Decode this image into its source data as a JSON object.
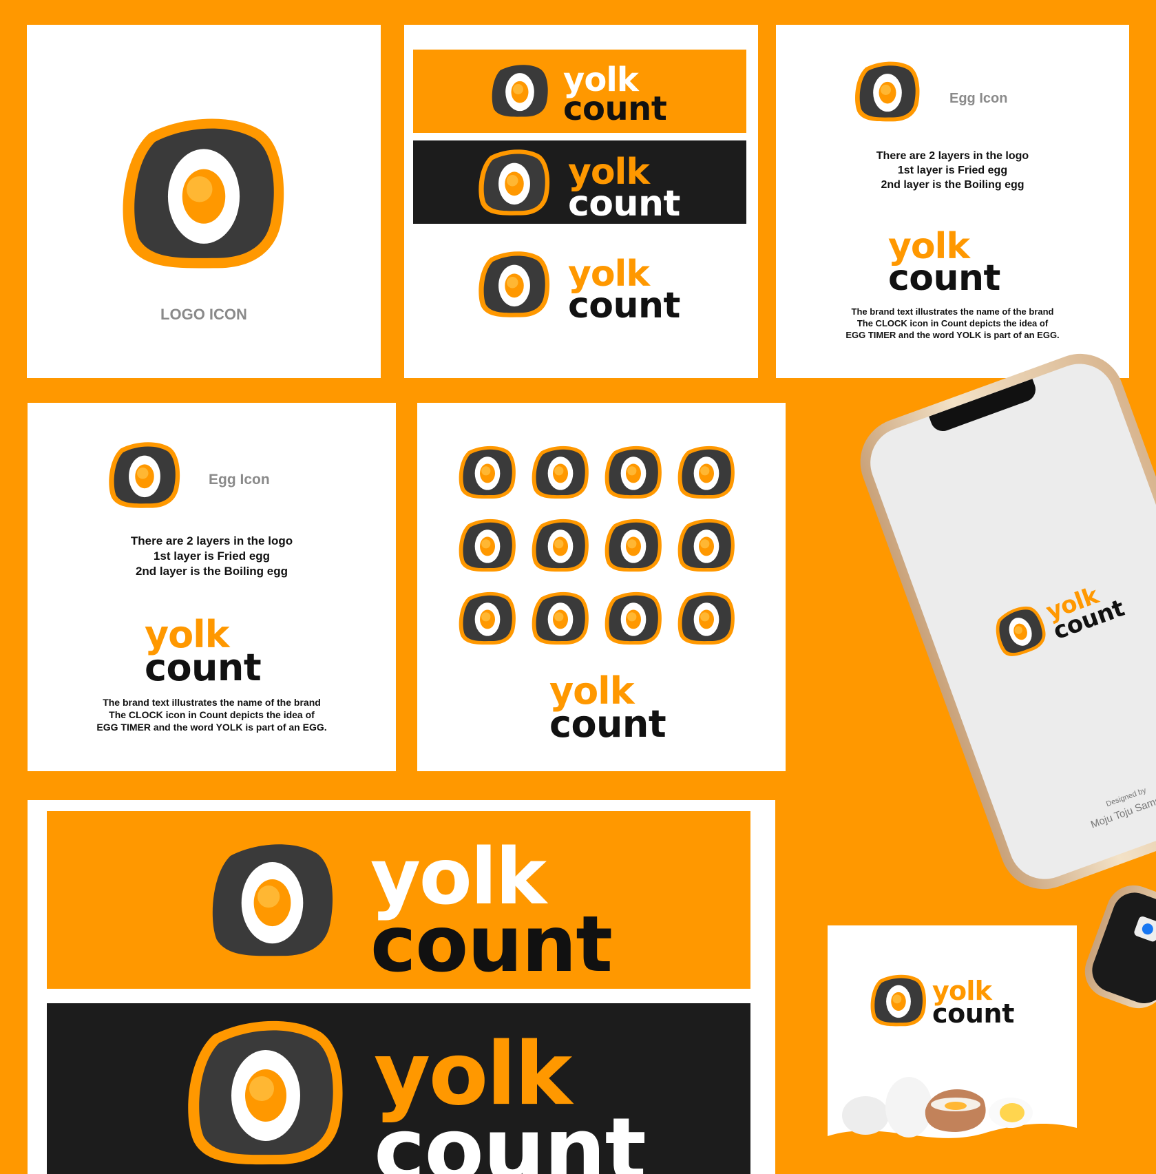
{
  "brand": {
    "word_top": "yolk",
    "word_bottom": "count"
  },
  "labels": {
    "logo_icon": "LOGO ICON",
    "egg_icon": "Egg Icon"
  },
  "layers_text": {
    "line1": "There are 2 layers in the logo",
    "line2": "1st layer is Fried egg",
    "line3": "2nd layer is the Boiling egg"
  },
  "brand_text": {
    "line1": "The brand text illustrates the name of the brand",
    "line2": "The CLOCK icon in Count depicts the idea of",
    "line3": "EGG TIMER and the word YOLK is part of an EGG."
  },
  "phone": {
    "designed_by": "Designed by",
    "designer": "Moju Toju Samson"
  },
  "colors": {
    "orange": "#FF9800",
    "dark": "#1C1C1C",
    "egg_gray": "#3A3A3A",
    "white": "#FFFFFF"
  }
}
